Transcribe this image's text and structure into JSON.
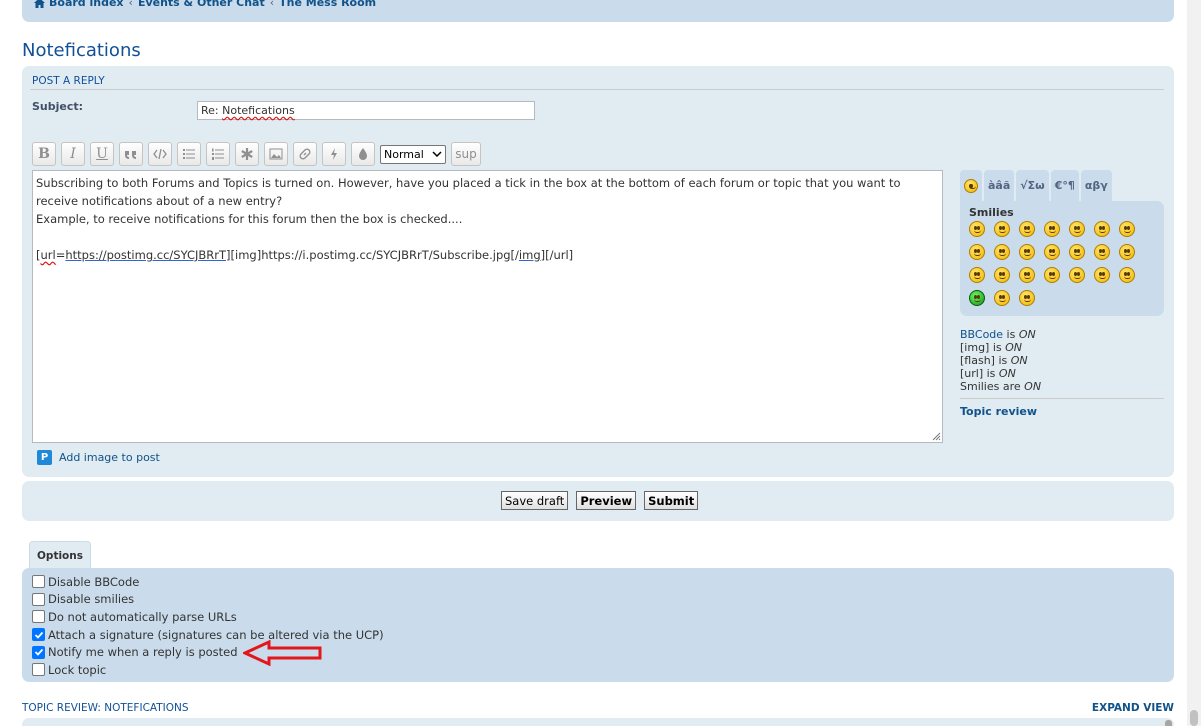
{
  "breadcrumbs": [
    "Board index",
    "Events & Other Chat",
    "The Mess Room"
  ],
  "page_title": "Notefications",
  "post_form": {
    "header": "POST A REPLY",
    "subject_label": "Subject:",
    "subject_value_prefix": "Re: ",
    "subject_value_word": "Notefications"
  },
  "toolbar": {
    "bold": "B",
    "italic": "I",
    "underline": "U",
    "font_size_value": "Normal",
    "sup": "sup"
  },
  "message": {
    "line1": "Subscribing to both Forums and Topics is turned on. However, have you placed a tick in the box at the bottom of each forum or topic that you want to",
    "line2": "receive notifications about of a new entry?",
    "line3": "Example, to receive notifications for this forum then the box is checked....",
    "line4_a": "[",
    "line4_b": "url",
    "line4_c": "=",
    "line4_d": "https://postimg.cc/SYCJBRrT]",
    "line4_e": "[img]https://i.postimg.cc/SYCJBRrT/Subscribe.jpg[/",
    "line4_f": "img",
    "line4_g": "][/url]"
  },
  "add_image_label": "Add image to post",
  "smiley_tabs": [
    "àâã",
    "√Σω",
    "€°¶",
    "αβγ"
  ],
  "smilies_heading": "Smilies",
  "status": {
    "bbcode_link": "BBCode",
    "bbcode_text": " is ",
    "bbcode_state": "ON",
    "img_text": "[img] is ",
    "img_state": "ON",
    "flash_text": "[flash] is ",
    "flash_state": "ON",
    "url_text": "[url] is ",
    "url_state": "ON",
    "smilies_text": "Smilies are ",
    "smilies_state": "ON"
  },
  "topic_review_link": "Topic review",
  "buttons": {
    "save_draft": "Save draft",
    "preview": "Preview",
    "submit": "Submit"
  },
  "options_tab": "Options",
  "options": [
    {
      "label": "Disable BBCode",
      "checked": false
    },
    {
      "label": "Disable smilies",
      "checked": false
    },
    {
      "label": "Do not automatically parse URLs",
      "checked": false
    },
    {
      "label": "Attach a signature (signatures can be altered via the UCP)",
      "checked": true
    },
    {
      "label": "Notify me when a reply is posted",
      "checked": true
    },
    {
      "label": "Lock topic",
      "checked": false
    }
  ],
  "topic_review_title": "TOPIC REVIEW: NOTEFICATIONS",
  "expand_view": "EXPAND VIEW",
  "colors": {
    "link": "#105289",
    "panel": "#e1ebf2",
    "panel_dark": "#cadceb",
    "arrow": "#e3161b"
  }
}
